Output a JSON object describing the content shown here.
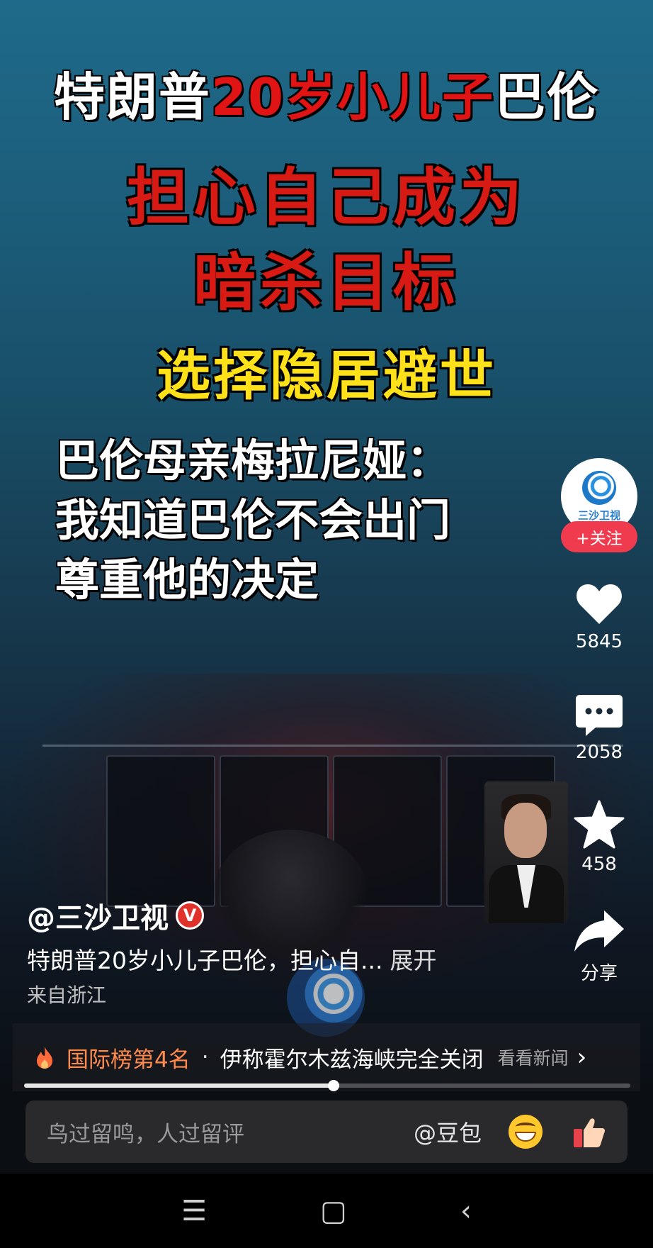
{
  "video": {
    "headline_line1_prefix": "特朗普",
    "headline_line1_red": "20岁小儿子",
    "headline_line1_suffix": "巴伦",
    "headline_line2": "担心自己成为",
    "headline_line3": "暗杀目标",
    "headline_line4": "选择隐居避世",
    "quote_lines": [
      "巴伦母亲梅拉尼娅：",
      "我知道巴伦不会出门",
      "尊重他的决定"
    ]
  },
  "channel": {
    "avatar_label": "三沙卫视",
    "follow_label": "+关注",
    "handle": "@三沙卫视",
    "verified_badge": "V"
  },
  "actions": {
    "likes": "5845",
    "comments": "2058",
    "favorites": "458",
    "share_label": "分享"
  },
  "caption": {
    "text": "特朗普20岁小儿子巴伦，担心自...",
    "expand_label": "展开",
    "location": "来自浙江"
  },
  "ranking": {
    "rank_label": "国际榜第4名",
    "separator": "·",
    "topic": "伊称霍尔木兹海峡完全关闭",
    "cta": "看看新闻",
    "chevron": "›"
  },
  "progress": {
    "fraction": 0.51
  },
  "comment_bar": {
    "placeholder": "鸟过留鸣，人过留评",
    "mention": "@豆包"
  },
  "navbar": {
    "menu_icon": "☰",
    "home_icon": "▢",
    "back_icon": "‹"
  },
  "colors": {
    "follow": "#f03b4f",
    "rank": "#ff8a4a",
    "headline_red": "#d81a14",
    "headline_yellow": "#ffe11a"
  },
  "icons": [
    "heart-icon",
    "comment-icon",
    "star-icon",
    "share-icon",
    "fire-icon",
    "laugh-emoji-icon",
    "thumbs-up-icon"
  ]
}
